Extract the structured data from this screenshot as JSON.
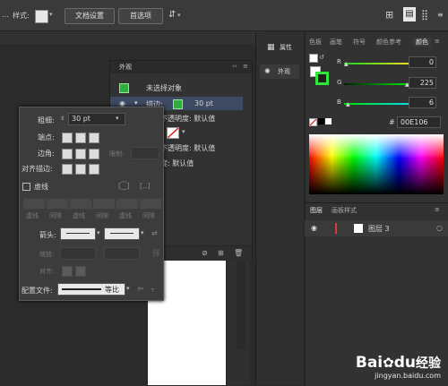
{
  "toolbar": {
    "style_label": "样式:",
    "doc_settings_label": "文档设置",
    "preferences_label": "首选项"
  },
  "appearance": {
    "title": "外观",
    "no_selection": "未选择对象",
    "stroke_label": "描边:",
    "stroke_value": "30 pt",
    "opacity_1": "不透明度: 默认值",
    "opacity_2": "不透明度: 默认值",
    "opacity_3": "度: 默认值"
  },
  "stroke": {
    "weight_label": "粗细:",
    "weight_value": "30 pt",
    "cap_label": "端点:",
    "corner_label": "边角:",
    "limit_label": "限制:",
    "align_label": "对齐描边:",
    "dashed_label": "虚线",
    "dash_labels": [
      "虚线",
      "间隙",
      "虚线",
      "间隙",
      "虚线",
      "间隙"
    ],
    "arrow_label": "箭头:",
    "scale_label": "缩放:",
    "align2_label": "对齐:",
    "profile_label": "配置文件:",
    "profile_value": "等比"
  },
  "midcol": {
    "properties_label": "属性",
    "appearance_label": "外观"
  },
  "color": {
    "tabs": [
      "色板",
      "画笔",
      "符号",
      "颜色参考",
      "颜色"
    ],
    "R": {
      "label": "R",
      "value": "0",
      "level": 0.0,
      "color": "#ff3b3b"
    },
    "G": {
      "label": "G",
      "value": "225",
      "level": 0.88,
      "color": "#3bd23b"
    },
    "B": {
      "label": "B",
      "value": "6",
      "level": 0.02,
      "color": "#3b6bff"
    },
    "hex_label": "#",
    "hex_value": "00E106"
  },
  "layers": {
    "tabs": [
      "图层",
      "画板样式"
    ],
    "layer_name": "图层 3"
  },
  "watermark": {
    "brand": "Bai",
    "brand2": "du",
    "jingyan": "经验",
    "url": "jingyan.baidu.com"
  }
}
